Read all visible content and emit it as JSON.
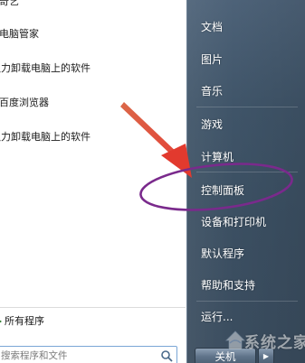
{
  "start_menu": {
    "programs": [
      {
        "label": "爱奇艺",
        "icon": "app-icon"
      },
      {
        "label": "电脑管家",
        "icon": "app-icon"
      },
      {
        "label": "强力卸载电脑上的软件",
        "icon": "app-icon"
      },
      {
        "label": "百度浏览器",
        "icon": "browser-icon"
      },
      {
        "label": "强力卸载电脑上的软件",
        "icon": "app-icon"
      }
    ],
    "all_programs_label": "所有程序",
    "search": {
      "placeholder": "搜索程序和文件"
    },
    "right_items": [
      {
        "label": "文档"
      },
      {
        "label": "图片"
      },
      {
        "label": "音乐"
      },
      {
        "label": "游戏"
      },
      {
        "label": "计算机"
      },
      {
        "label": "控制面板"
      },
      {
        "label": "设备和打印机"
      },
      {
        "label": "默认程序"
      },
      {
        "label": "帮助和支持"
      },
      {
        "label": "运行..."
      }
    ],
    "shutdown_label": "关机",
    "shutdown_arrow_icon": "triangle-right-icon"
  },
  "annotations": {
    "arrow_color": "#e04a3a",
    "ellipse_color": "#7a2a8c"
  },
  "watermark": {
    "text": "系统之家",
    "icon": "house-logo-icon"
  },
  "colors": {
    "right_pane": "#3f5468",
    "text_dark": "#1a1a1a",
    "text_light": "#ffffff"
  }
}
